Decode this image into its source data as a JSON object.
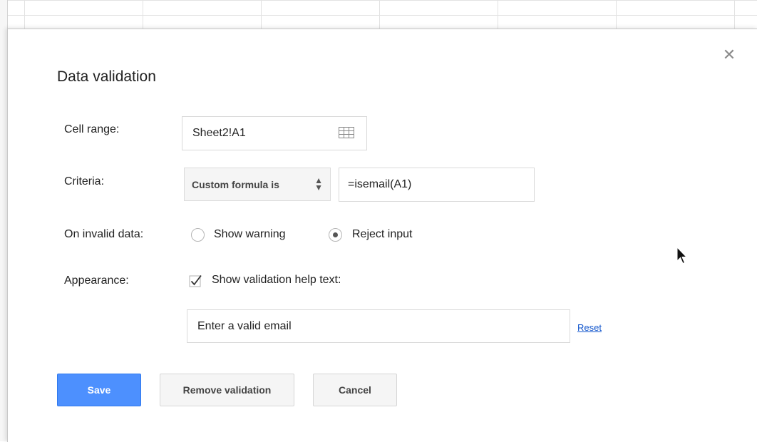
{
  "dialog": {
    "title": "Data validation",
    "close_icon": "close-icon"
  },
  "cell_range": {
    "label": "Cell range:",
    "value": "Sheet2!A1",
    "icon": "grid-icon"
  },
  "criteria": {
    "label": "Criteria:",
    "type_value": "Custom formula is",
    "formula_value": "=isemail(A1)"
  },
  "on_invalid": {
    "label": "On invalid data:",
    "options": [
      {
        "label": "Show warning",
        "selected": false
      },
      {
        "label": "Reject input",
        "selected": true
      }
    ]
  },
  "appearance": {
    "label": "Appearance:",
    "checkbox_label": "Show validation help text:",
    "checked": true,
    "help_text_value": "Enter a valid email",
    "reset_label": "Reset"
  },
  "buttons": {
    "save": "Save",
    "remove": "Remove validation",
    "cancel": "Cancel"
  },
  "colors": {
    "primary_button": "#4d90fe",
    "link": "#1155cc"
  }
}
